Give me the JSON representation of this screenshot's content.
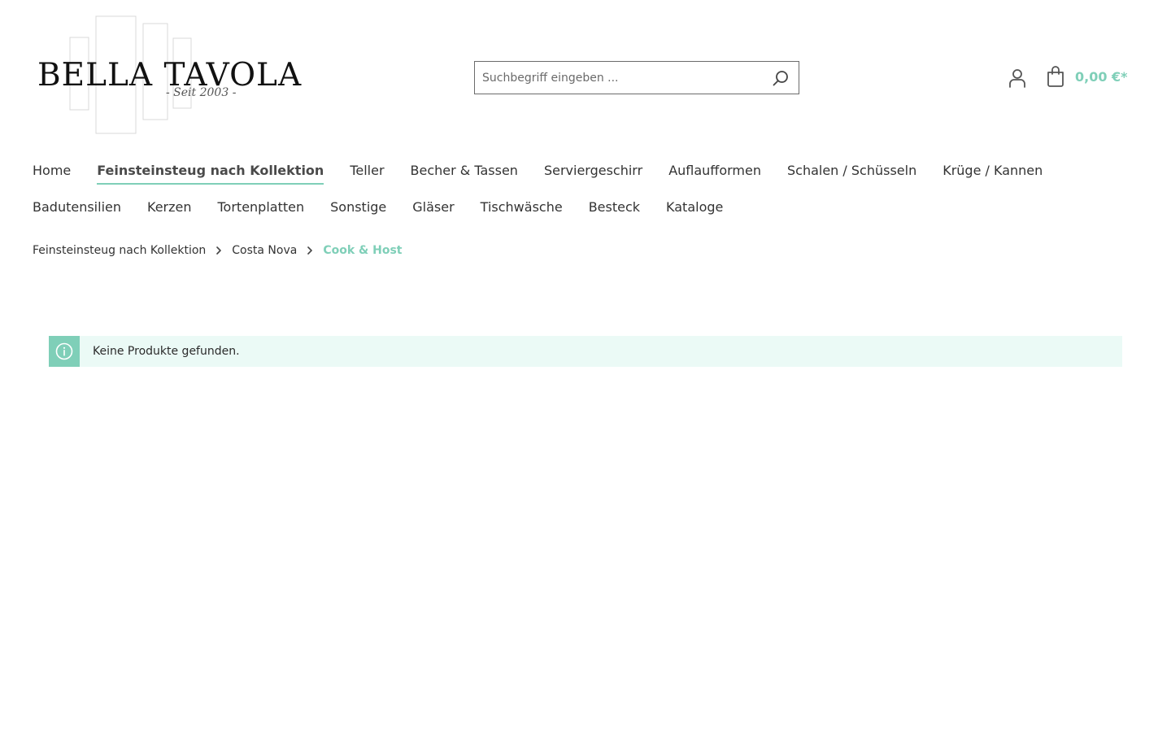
{
  "header": {
    "logo": {
      "name": "BELLA TAVOLA",
      "tagline": "- Seit 2003 -"
    },
    "search": {
      "placeholder": "Suchbegriff eingeben ...",
      "value": "",
      "icon": "search-icon"
    },
    "account": {
      "icon": "user-icon"
    },
    "cart": {
      "icon": "shopping-bag-icon",
      "total": "0,00 €*"
    }
  },
  "nav": {
    "row1": [
      {
        "label": "Home",
        "active": false
      },
      {
        "label": "Feinsteinsteug nach Kollektion",
        "active": true
      },
      {
        "label": "Teller",
        "active": false
      },
      {
        "label": "Becher & Tassen",
        "active": false
      },
      {
        "label": "Serviergeschirr",
        "active": false
      },
      {
        "label": "Auflaufformen",
        "active": false
      },
      {
        "label": "Schalen / Schüsseln",
        "active": false
      },
      {
        "label": "Krüge / Kannen",
        "active": false
      }
    ],
    "row2": [
      {
        "label": "Badutensilien",
        "active": false
      },
      {
        "label": "Kerzen",
        "active": false
      },
      {
        "label": "Tortenplatten",
        "active": false
      },
      {
        "label": "Sonstige",
        "active": false
      },
      {
        "label": "Gläser",
        "active": false
      },
      {
        "label": "Tischwäsche",
        "active": false
      },
      {
        "label": "Besteck",
        "active": false
      },
      {
        "label": "Kataloge",
        "active": false
      }
    ]
  },
  "breadcrumb": {
    "items": [
      "Feinsteinsteug nach Kollektion",
      "Costa Nova",
      "Cook & Host"
    ],
    "separator_icon": "chevron-right-icon"
  },
  "alert": {
    "icon": "info-icon",
    "message": "Keine Produkte gefunden."
  },
  "colors": {
    "accent": "#7fcfb8",
    "alert_background": "#ebfaf6",
    "text": "#333333"
  }
}
